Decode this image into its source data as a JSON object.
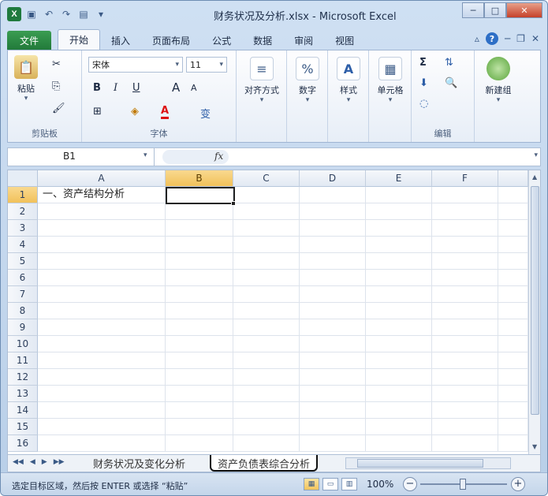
{
  "window": {
    "title": "财务状况及分析.xlsx - Microsoft Excel",
    "qat_icons": [
      "excel-logo-icon",
      "save-icon",
      "undo-icon",
      "redo-icon",
      "print-preview-icon",
      "customize-icon"
    ]
  },
  "tabs": [
    "文件",
    "开始",
    "插入",
    "页面布局",
    "公式",
    "数据",
    "审阅",
    "视图"
  ],
  "ribbon": {
    "clipboard": {
      "paste": "粘贴",
      "label": "剪贴板"
    },
    "font": {
      "name": "宋体",
      "size": "11",
      "label": "字体",
      "bold": "B",
      "italic": "I",
      "underline": "U",
      "grow": "A",
      "shrink": "A",
      "phonetic": "变"
    },
    "alignment": {
      "label": "对齐方式"
    },
    "number": {
      "label": "数字",
      "glyph": "%"
    },
    "styles": {
      "label": "样式",
      "glyph": "A"
    },
    "cells": {
      "label": "单元格"
    },
    "editing": {
      "label": "编辑",
      "sum": "Σ"
    },
    "new_group": {
      "label": "新建组"
    }
  },
  "formula_bar": {
    "name_box": "B1",
    "fx": "fx",
    "formula": ""
  },
  "grid": {
    "columns": [
      "A",
      "B",
      "C",
      "D",
      "E",
      "F"
    ],
    "selected_column": "B",
    "rows": [
      "1",
      "2",
      "3",
      "4",
      "5",
      "6",
      "7",
      "8",
      "9",
      "10",
      "11",
      "12",
      "13",
      "14",
      "15",
      "16"
    ],
    "selected_row": "1",
    "cells": {
      "A1": "一、资产结构分析"
    }
  },
  "sheets": [
    "财务状况及变化分析",
    "资产负债表综合分析"
  ],
  "active_sheet": "资产负债表综合分析",
  "status": {
    "message": "选定目标区域，然后按 ENTER 或选择 “粘贴”",
    "zoom": "100%"
  }
}
